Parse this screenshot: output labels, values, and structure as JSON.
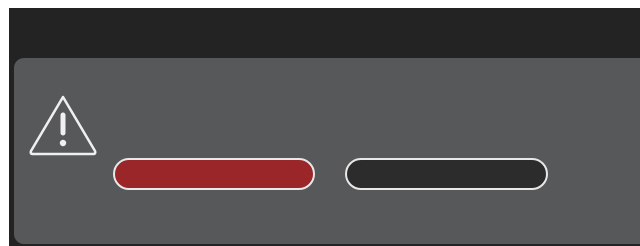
{
  "dialog": {
    "icon": "warning-icon",
    "primary_button": {
      "label": "",
      "color": "#9a2629"
    },
    "secondary_button": {
      "label": "",
      "color": "#2c2c2d"
    }
  },
  "colors": {
    "top_bar": "#232323",
    "dialog_background": "#575859",
    "button_outline": "#e8e8e8",
    "icon_stroke": "#f0f0f0"
  }
}
